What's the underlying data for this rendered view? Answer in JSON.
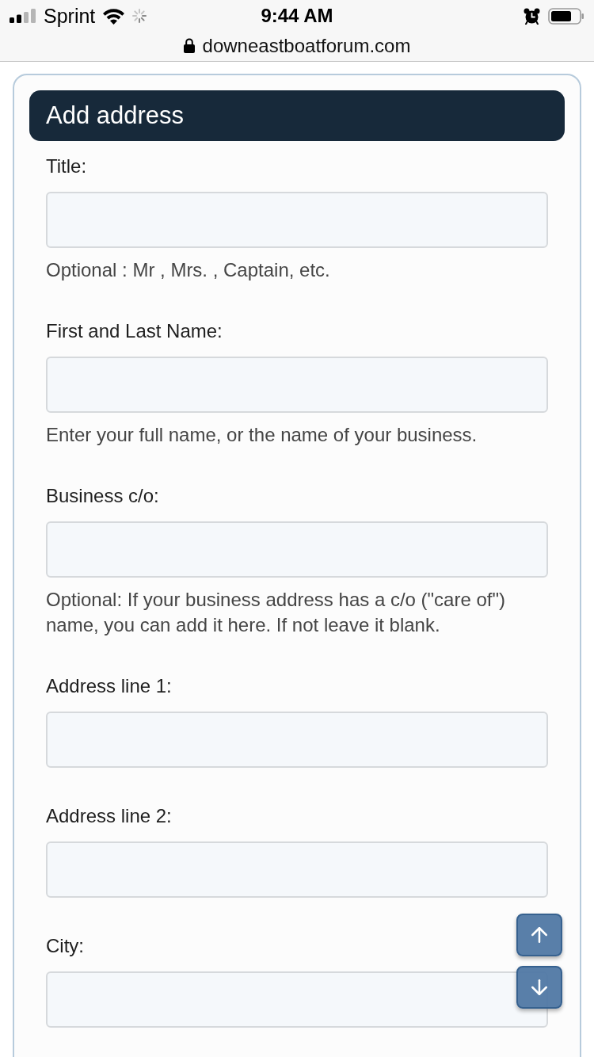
{
  "status_bar": {
    "carrier": "Sprint",
    "time": "9:44 AM"
  },
  "address_bar": {
    "url": "downeastboatforum.com"
  },
  "form": {
    "title": "Add address",
    "fields": [
      {
        "label": "Title:",
        "help": "Optional : Mr , Mrs. , Captain, etc."
      },
      {
        "label": "First and Last Name:",
        "help": "Enter your full name, or the name of your business."
      },
      {
        "label": "Business c/o:",
        "help": "Optional: If your business address has a c/o (\"care of\") name, you can add it here. If not leave it blank."
      },
      {
        "label": "Address line 1:"
      },
      {
        "label": "Address line 2:"
      },
      {
        "label": "City:"
      }
    ]
  }
}
